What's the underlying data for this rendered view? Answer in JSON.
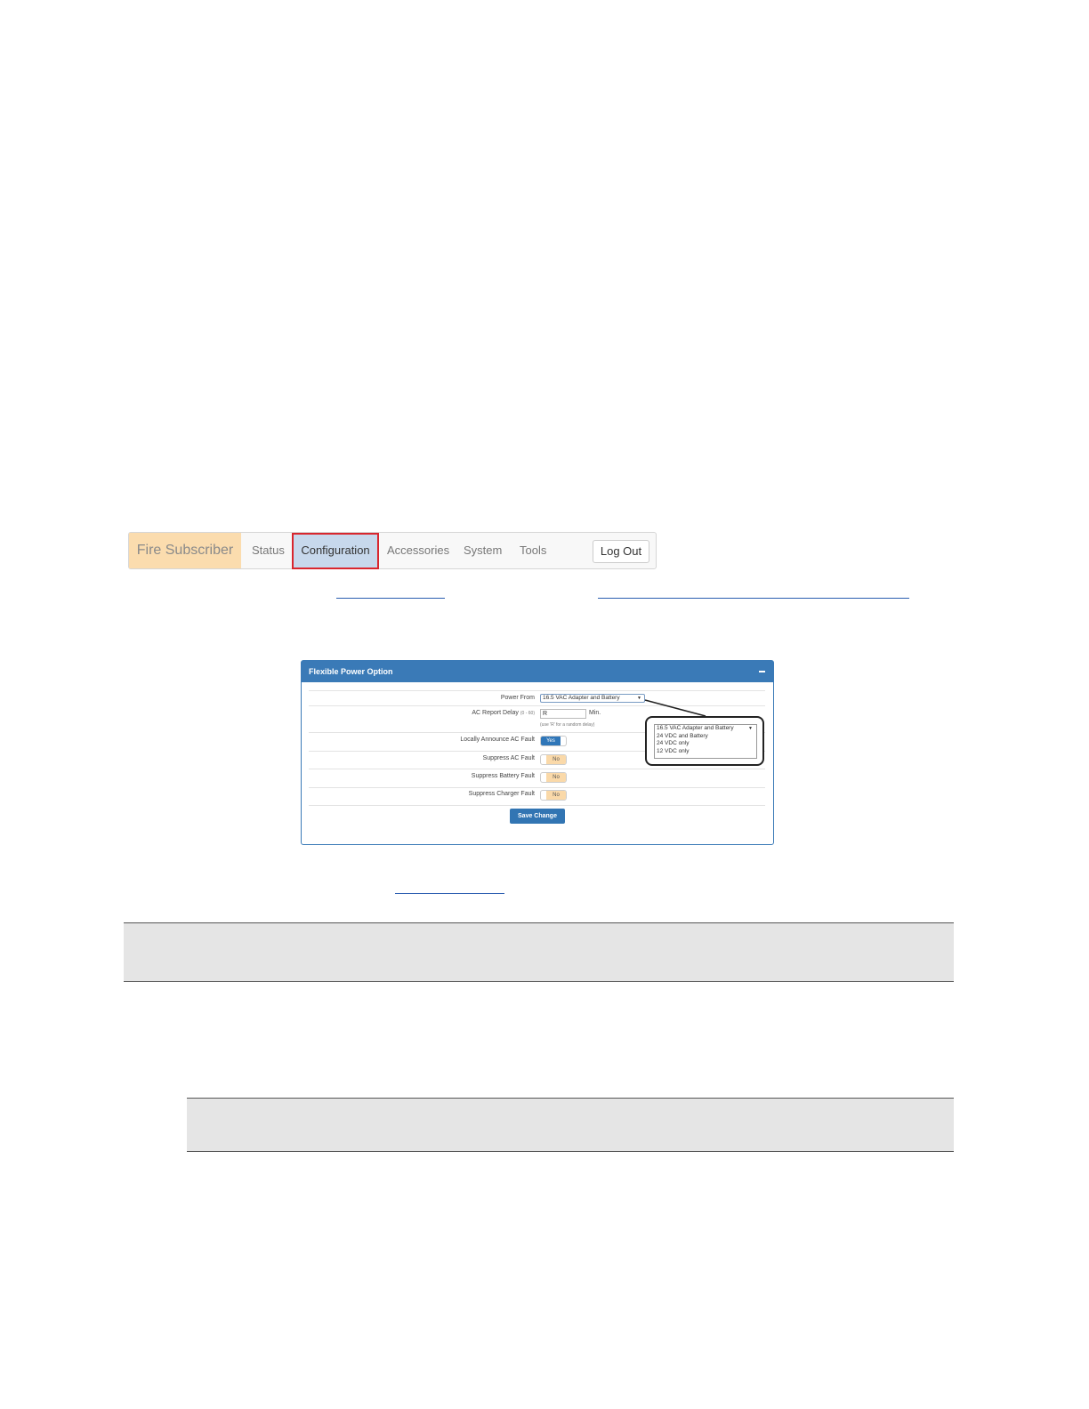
{
  "navbar": {
    "brand": "Fire Subscriber",
    "items": [
      "Status",
      "Configuration",
      "Accessories",
      "System",
      "Tools"
    ],
    "logout": "Log Out"
  },
  "panel": {
    "title": "Flexible Power Option",
    "power_from_label": "Power From",
    "power_from_value": "16.5 VAC Adapter and Battery",
    "ac_delay_label": "AC Report Delay",
    "ac_delay_range": "(0 - 60)",
    "ac_delay_value": "R",
    "ac_delay_unit": "Min.",
    "ac_delay_hint": "(use 'R' for a random delay)",
    "rows": [
      {
        "label": "Locally Announce AC Fault",
        "value": "Yes"
      },
      {
        "label": "Suppress AC Fault",
        "value": "No"
      },
      {
        "label": "Suppress Battery Fault",
        "value": "No"
      },
      {
        "label": "Suppress Charger Fault",
        "value": "No"
      }
    ],
    "save_label": "Save Change",
    "dropdown_options": [
      "16.5 VAC Adapter and Battery",
      "24 VDC and Battery",
      "24 VDC only",
      "12 VDC only"
    ]
  }
}
